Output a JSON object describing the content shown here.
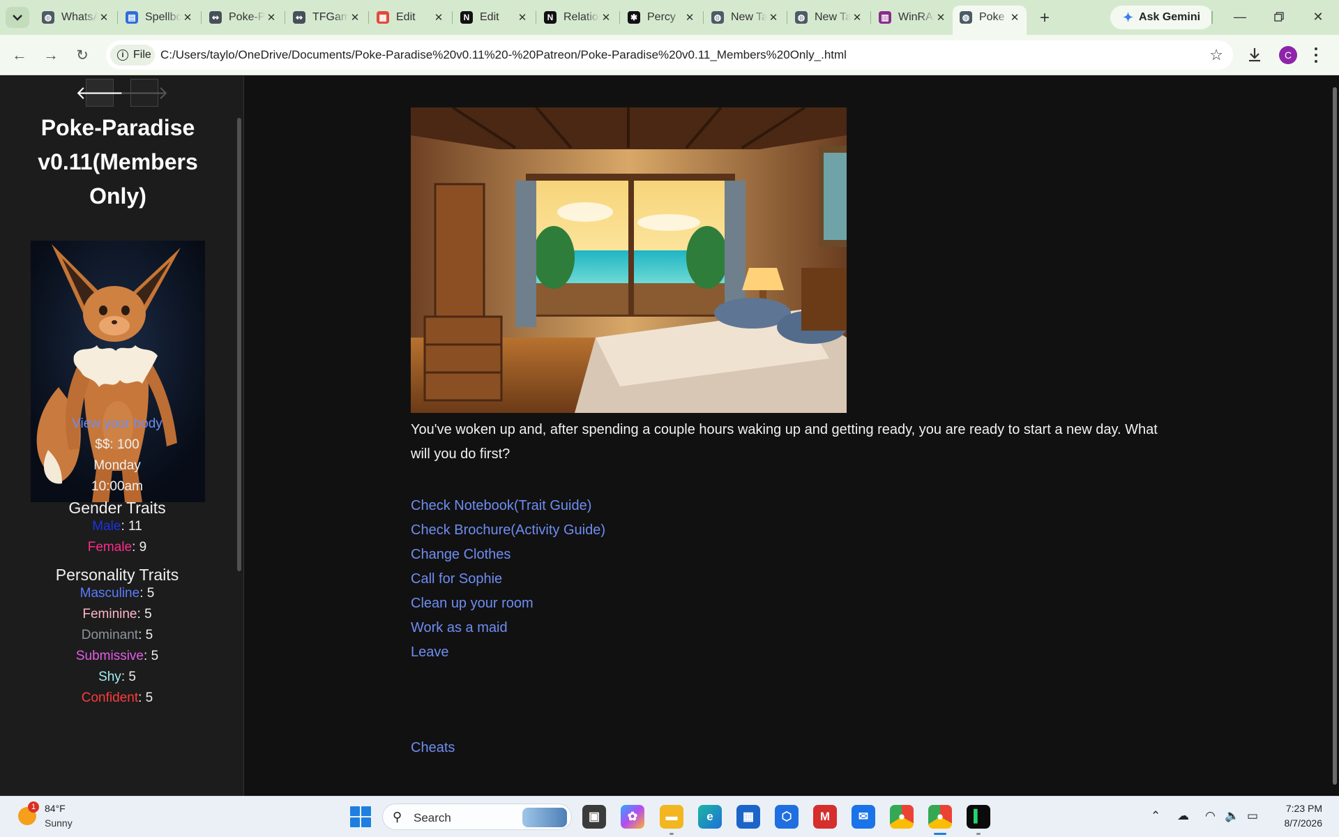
{
  "browser": {
    "tabs": [
      {
        "title": "WhatsApp",
        "favicon": "globe-icon"
      },
      {
        "title": "Spellbook",
        "favicon": "docs-icon"
      },
      {
        "title": "Poke-Paradise",
        "favicon": "link-icon"
      },
      {
        "title": "TFGames",
        "favicon": "link-icon"
      },
      {
        "title": "Edit",
        "favicon": "calendar-icon"
      },
      {
        "title": "Edit",
        "favicon": "notion-icon"
      },
      {
        "title": "Relations",
        "favicon": "notion-icon"
      },
      {
        "title": "Percy",
        "favicon": "paw-icon"
      },
      {
        "title": "New Tab",
        "favicon": "globe-icon"
      },
      {
        "title": "New Tab",
        "favicon": "globe-icon"
      },
      {
        "title": "WinRAR",
        "favicon": "winrar-icon"
      },
      {
        "title": "Poke",
        "favicon": "globe-icon"
      }
    ],
    "gemini_label": "Ask Gemini",
    "site_chip": "File",
    "url": "C:/Users/taylo/OneDrive/Documents/Poke-Paradise%20v0.11%20-%20Patreon/Poke-Paradise%20v0.11_Members%20Only_.html",
    "profile_initial": "C"
  },
  "sidebar": {
    "back_glyph": "🡐",
    "forward_glyph": "🡒",
    "title": "Poke-Paradise v0.11(Members Only)",
    "view_body_link": "View your body",
    "money_label": "$$: 100",
    "day": "Monday",
    "time": "10:00am",
    "gender_heading": "Gender Traits",
    "gender_traits": [
      {
        "name": "Male",
        "value": ": 11",
        "color": "#1a33e6"
      },
      {
        "name": "Female",
        "value": ": 9",
        "color": "#ff2b8a"
      }
    ],
    "personality_heading": "Personality Traits",
    "personality_traits": [
      {
        "name": "Masculine",
        "value": ": 5",
        "color": "#5b7cff"
      },
      {
        "name": "Feminine",
        "value": ": 5",
        "color": "#ffb6c9"
      },
      {
        "name": "Dominant",
        "value": ": 5",
        "color": "#8d939c"
      },
      {
        "name": "Submissive",
        "value": ": 5",
        "color": "#e45de8"
      },
      {
        "name": "Shy",
        "value": ": 5",
        "color": "#9ff0ee"
      },
      {
        "name": "Confident",
        "value": ": 5",
        "color": "#ff3b3b"
      }
    ]
  },
  "main": {
    "narrative": "You've woken up and, after spending a couple hours waking up and getting ready, you are ready to start a new day. What will you do first?",
    "choices": [
      "Check Notebook(Trait Guide)",
      "Check Brochure(Activity Guide)",
      "Change Clothes",
      "Call for Sophie",
      "Clean up your room",
      "Work as a maid",
      "Leave"
    ],
    "cheats_link": "Cheats"
  },
  "taskbar": {
    "weather_alert_count": "1",
    "weather_temp": "84°F",
    "weather_condition": "Sunny",
    "search_label": "Search",
    "time": "7:23 PM",
    "date": "8/7/2026"
  },
  "colors": {
    "link": "#6f8df2",
    "page_bg": "#111111",
    "sidebar_bg": "#1c1c1c",
    "tabstrip_bg": "#d5e9cf"
  }
}
